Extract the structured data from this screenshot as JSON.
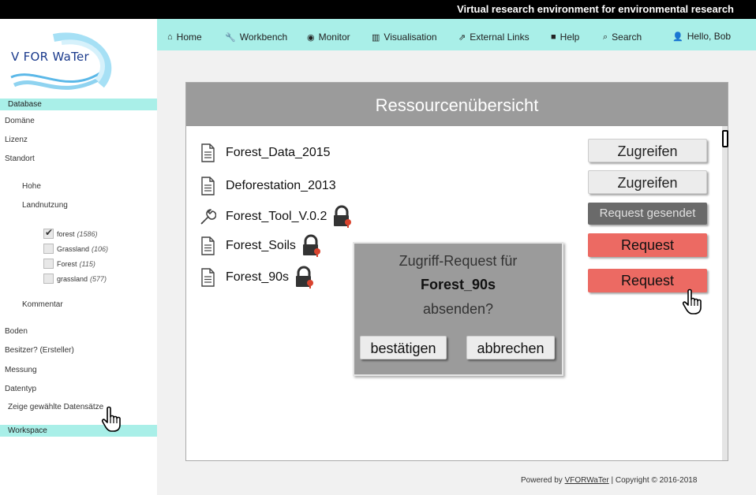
{
  "header": {
    "tagline": "Virtual research environment for environmental research"
  },
  "logo": {
    "text": "V FOR WaTer"
  },
  "nav": {
    "items": [
      {
        "icon": "⌂",
        "label": "Home"
      },
      {
        "icon": "🔧",
        "label": "Workbench"
      },
      {
        "icon": "◉",
        "label": "Monitor"
      },
      {
        "icon": "▥",
        "label": "Visualisation"
      },
      {
        "icon": "⇗",
        "label": "External Links"
      },
      {
        "icon": "■",
        "label": "Help"
      },
      {
        "icon": "⌕",
        "label": "Search"
      }
    ],
    "user": {
      "icon": "👤",
      "label": "Hello, Bob"
    }
  },
  "sidebar": {
    "database_label": "Database",
    "filters": [
      "Domäne",
      "Lizenz",
      "Standort"
    ],
    "standort_sub": [
      "Hohe",
      "Landnutzung"
    ],
    "landuse_options": [
      {
        "label": "forest",
        "count": "(1586)",
        "checked": true
      },
      {
        "label": "Grassland",
        "count": "(106)",
        "checked": false
      },
      {
        "label": "Forest",
        "count": "(115)",
        "checked": false
      },
      {
        "label": "grassland",
        "count": "(577)",
        "checked": false
      }
    ],
    "kommentar": "Kommentar",
    "more_filters": [
      "Boden",
      "Besitzer? (Ersteller)",
      "Messung",
      "Datentyp"
    ],
    "show_selected": "Zeige gewählte Datensätze",
    "workspace_label": "Workspace"
  },
  "panel": {
    "title": "Ressourcenübersicht",
    "resources": [
      {
        "name": "Forest_Data_2015",
        "icon": "document-icon",
        "locked": false,
        "action": "Zugreifen",
        "action_type": "access"
      },
      {
        "name": "Deforestation_2013",
        "icon": "document-icon",
        "locked": false,
        "action": "Zugreifen",
        "action_type": "access"
      },
      {
        "name": "Forest_Tool_V.0.2",
        "icon": "wrench-icon",
        "locked": true,
        "action": "Request gesendet",
        "action_type": "sent"
      },
      {
        "name": "Forest_Soils",
        "icon": "document-icon",
        "locked": true,
        "action": "Request",
        "action_type": "request"
      },
      {
        "name": "Forest_90s",
        "icon": "document-icon",
        "locked": true,
        "action": "Request",
        "action_type": "request"
      }
    ]
  },
  "dialog": {
    "line1": "Zugriff-Request für",
    "resource": "Forest_90s",
    "line3": "absenden?",
    "confirm": "bestätigen",
    "cancel": "abbrechen"
  },
  "footer": {
    "powered_by": "Powered by",
    "brand": "VFORWaTer",
    "copyright": "| Copyright © 2016-2018"
  },
  "colors": {
    "accent": "#a9efe8",
    "panel_header": "#9b9b9b",
    "request_button": "#ec6a63",
    "sent_button": "#6a6a6a"
  }
}
